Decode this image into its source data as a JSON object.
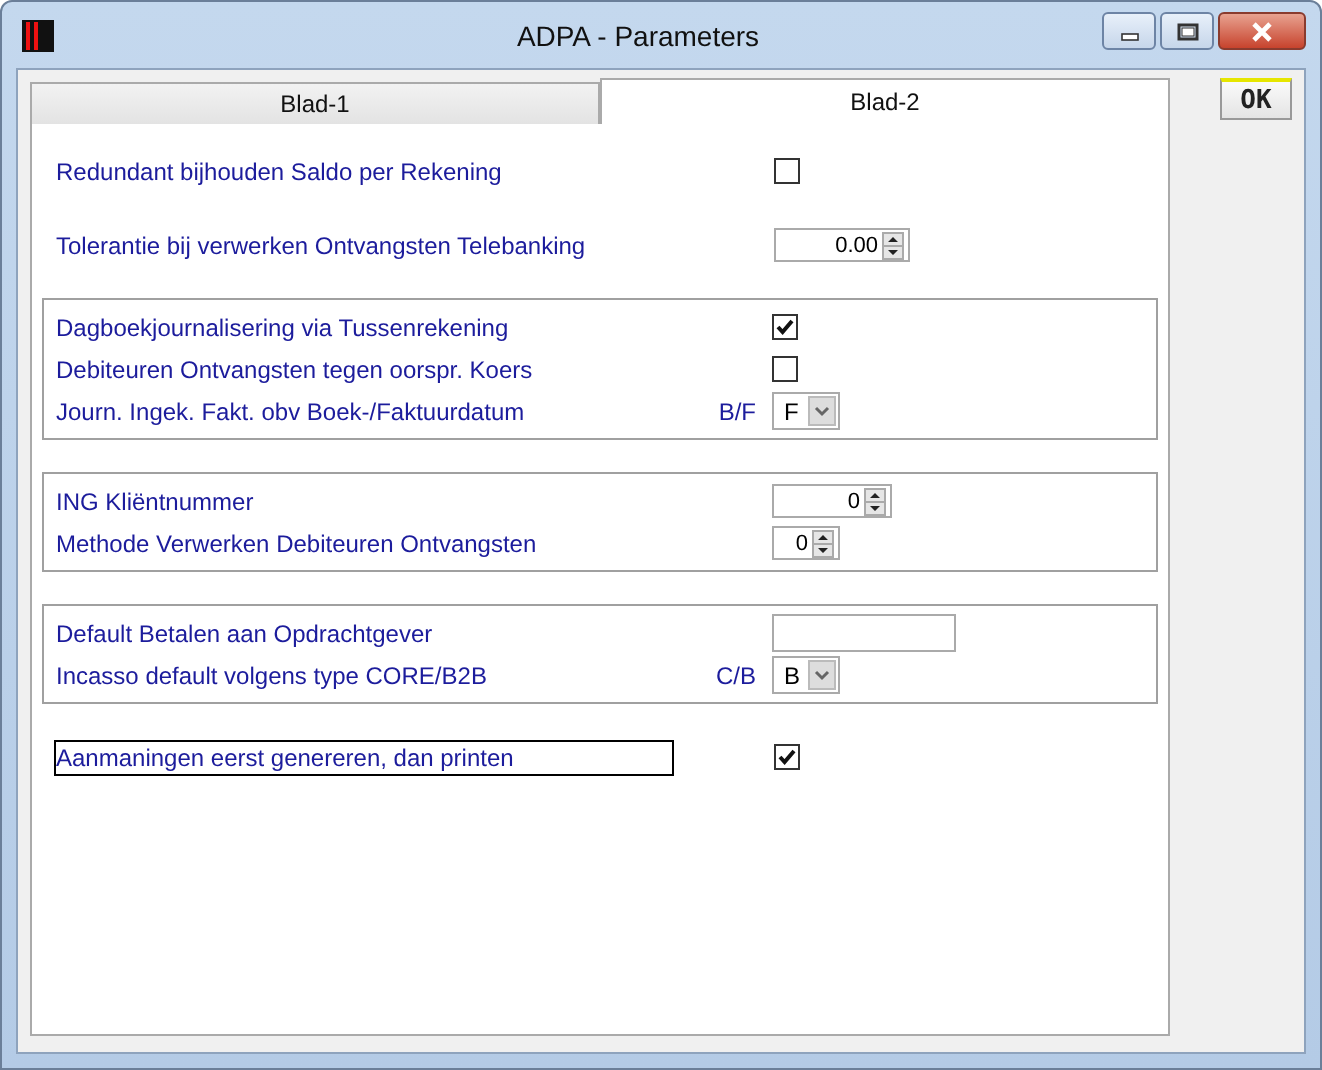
{
  "window": {
    "title": "ADPA - Parameters"
  },
  "tabs": [
    {
      "label": "Blad-1",
      "selected": false
    },
    {
      "label": "Blad-2",
      "selected": true
    }
  ],
  "sections": [
    {
      "boxed": false,
      "rows": [
        {
          "kind": "checkbox",
          "label": "Redundant bijhouden Saldo per Rekening",
          "checked": false,
          "focused": false
        }
      ]
    },
    {
      "boxed": false,
      "rows": [
        {
          "kind": "spinner",
          "label": "Tolerantie bij verwerken Ontvangsten Telebanking",
          "value": "0.00",
          "focused": false
        }
      ]
    },
    {
      "boxed": true,
      "rows": [
        {
          "kind": "checkbox",
          "label": "Dagboekjournalisering via Tussenrekening",
          "checked": true,
          "focused": false
        },
        {
          "kind": "checkbox",
          "label": "Debiteuren Ontvangsten tegen oorspr. Koers",
          "checked": false,
          "focused": false
        },
        {
          "kind": "combo",
          "label": "Journ. Ingek. Fakt. obv Boek-/Faktuurdatum",
          "suffix": "B/F",
          "value": "F",
          "focused": false
        }
      ]
    },
    {
      "boxed": true,
      "rows": [
        {
          "kind": "spinner",
          "label": "ING Kliëntnummer",
          "value": "0",
          "focused": false
        },
        {
          "kind": "spinner",
          "label": "Methode Verwerken Debiteuren Ontvangsten",
          "value": "0",
          "focused": false
        }
      ]
    },
    {
      "boxed": true,
      "rows": [
        {
          "kind": "text",
          "label": "Default Betalen aan Opdrachtgever",
          "focused": false
        },
        {
          "kind": "combo",
          "label": "Incasso default volgens type CORE/B2B",
          "suffix": "C/B",
          "value": "B",
          "focused": false
        }
      ]
    },
    {
      "boxed": false,
      "rows": [
        {
          "kind": "checkbox",
          "label": "Aanmaningen eerst genereren, dan printen",
          "checked": true,
          "focused": true
        }
      ]
    }
  ],
  "ok_button": "OK"
}
